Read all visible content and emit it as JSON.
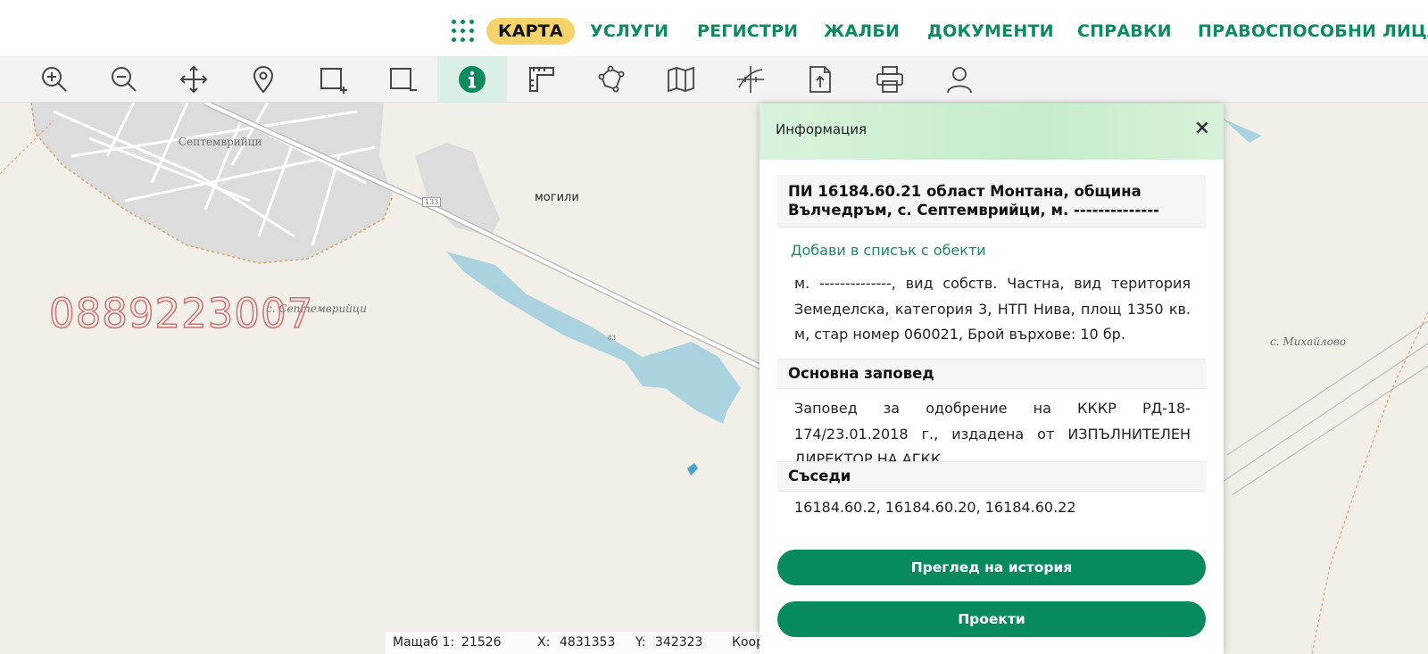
{
  "nav": {
    "items": [
      {
        "label": "КАРТА",
        "active": true
      },
      {
        "label": "УСЛУГИ"
      },
      {
        "label": "РЕГИСТРИ"
      },
      {
        "label": "ЖАЛБИ"
      },
      {
        "label": "ДОКУМЕНТИ"
      },
      {
        "label": "СПРАВКИ"
      },
      {
        "label": "ПРАВОСПОСОБНИ ЛИЦА"
      }
    ],
    "apps_icon": "apps-grid-icon",
    "accent_color": "#0e8a5f",
    "active_bg": "#f7d46a"
  },
  "toolbar": {
    "tools": [
      {
        "icon": "zoom-in-icon"
      },
      {
        "icon": "zoom-out-icon"
      },
      {
        "icon": "pan-icon"
      },
      {
        "icon": "location-pin-icon"
      },
      {
        "icon": "box-zoom-in-icon"
      },
      {
        "icon": "box-zoom-out-icon"
      },
      {
        "icon": "info-icon",
        "active": true
      },
      {
        "icon": "measure-icon"
      },
      {
        "icon": "polygon-icon"
      },
      {
        "icon": "map-layers-icon"
      },
      {
        "icon": "coordinates-icon"
      },
      {
        "icon": "upload-document-icon"
      },
      {
        "icon": "print-icon"
      },
      {
        "icon": "user-icon"
      }
    ]
  },
  "map": {
    "labels": {
      "village_top": "Септемврийци",
      "mogili": "могили",
      "village_mid": "с. Септемврийци",
      "mihaylovo": "с. Михайлово",
      "road": "133",
      "lake": "83"
    },
    "watermark": "0889223007"
  },
  "status": {
    "scale_label": "Мащаб 1:",
    "scale_value": "21526",
    "x_label": "X:",
    "x_value": "4831353",
    "y_label": "Y:",
    "y_value": "342323",
    "coords_label": "Коор"
  },
  "panel": {
    "title": "Информация",
    "close": "×",
    "pi_title": "ПИ 16184.60.21 област Монтана, община Вълчедръм, с. Септемврийци, м. --------------",
    "add_link": "Добави в списък с обекти",
    "description": "м. --------------, вид собств. Частна, вид територия Земеделска, категория 3, НТП Нива, площ 1350 кв. м, стар номер 060021, Брой върхове: 10 бр.",
    "order_head": "Основна заповед",
    "order_text": "Заповед за одобрение на КККР РД-18-174/23.01.2018 г., издадена от ИЗПЪЛНИТЕЛЕН ДИРЕКТОР НА АГКК",
    "neighbors_head": "Съседи",
    "neighbors": "16184.60.2, 16184.60.20, 16184.60.22",
    "btn_history": "Преглед на история",
    "btn_projects": "Проекти"
  }
}
